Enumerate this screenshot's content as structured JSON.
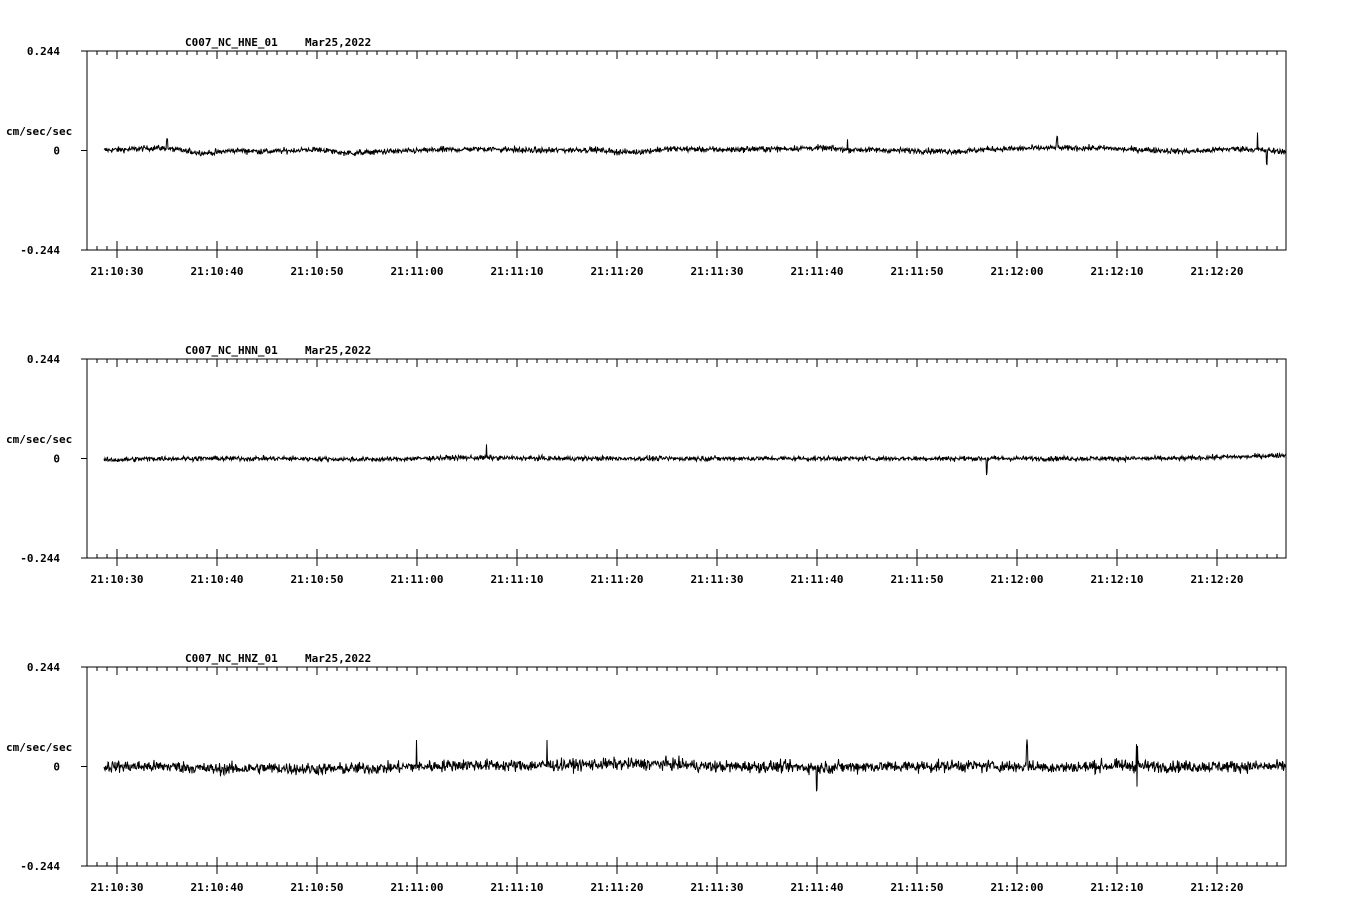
{
  "chart_data": [
    {
      "type": "line",
      "title": "C007_NC_HNE_01",
      "date": "Mar25,2022",
      "ylabel": "cm/sec/sec",
      "y_ticks": [
        "0.244",
        "0",
        "-0.244"
      ],
      "ylim": [
        -0.244,
        0.244
      ],
      "x_ticks": [
        "21:10:30",
        "21:10:40",
        "21:10:50",
        "21:11:00",
        "21:11:10",
        "21:11:20",
        "21:11:30",
        "21:11:40",
        "21:11:50",
        "21:12:00",
        "21:12:10",
        "21:12:20"
      ],
      "series": [
        {
          "color": "#000000",
          "noise_amplitude": 0.012,
          "x": [
            "21:10:28",
            "21:10:30",
            "21:10:34",
            "21:10:39",
            "21:10:42",
            "21:10:45",
            "21:10:50",
            "21:10:53",
            "21:10:58",
            "21:11:03",
            "21:11:07",
            "21:11:12",
            "21:11:17",
            "21:11:21",
            "21:11:26",
            "21:11:30",
            "21:11:35",
            "21:11:40",
            "21:11:44",
            "21:11:49",
            "21:11:54",
            "21:11:58",
            "21:12:03",
            "21:12:08",
            "21:12:12",
            "21:12:17",
            "21:12:22",
            "21:12:27"
          ],
          "values": [
            0.0,
            0.002,
            0.006,
            -0.006,
            0.0,
            -0.002,
            0.002,
            -0.006,
            -0.002,
            0.002,
            0.004,
            0.0,
            0.002,
            -0.004,
            0.004,
            0.002,
            0.004,
            0.006,
            0.002,
            0.0,
            -0.002,
            0.004,
            0.006,
            0.006,
            0.002,
            -0.002,
            0.004,
            -0.002
          ],
          "peaks": [
            {
              "x": "21:10:35",
              "value": 0.03
            },
            {
              "x": "21:11:43",
              "value": 0.028
            },
            {
              "x": "21:12:04",
              "value": 0.035
            },
            {
              "x": "21:12:24",
              "value": 0.045
            },
            {
              "x": "21:12:25",
              "value": -0.035
            }
          ]
        }
      ]
    },
    {
      "type": "line",
      "title": "C007_NC_HNN_01",
      "date": "Mar25,2022",
      "ylabel": "cm/sec/sec",
      "y_ticks": [
        "0.244",
        "0",
        "-0.244"
      ],
      "ylim": [
        -0.244,
        0.244
      ],
      "x_ticks": [
        "21:10:30",
        "21:10:40",
        "21:10:50",
        "21:11:00",
        "21:11:10",
        "21:11:20",
        "21:11:30",
        "21:11:40",
        "21:11:50",
        "21:12:00",
        "21:12:10",
        "21:12:20"
      ],
      "series": [
        {
          "color": "#000000",
          "noise_amplitude": 0.01,
          "x": [
            "21:10:28",
            "21:10:35",
            "21:10:45",
            "21:10:55",
            "21:11:05",
            "21:11:15",
            "21:11:25",
            "21:11:35",
            "21:11:45",
            "21:11:55",
            "21:12:05",
            "21:12:15",
            "21:12:22",
            "21:12:27"
          ],
          "values": [
            -0.004,
            0.0,
            0.0,
            -0.002,
            0.002,
            0.0,
            0.0,
            0.0,
            0.0,
            0.0,
            0.0,
            0.0,
            0.004,
            0.008
          ],
          "peaks": [
            {
              "x": "21:11:07",
              "value": 0.035
            },
            {
              "x": "21:11:57",
              "value": -0.045
            },
            {
              "x": "21:12:27",
              "value": 0.04
            }
          ]
        }
      ]
    },
    {
      "type": "line",
      "title": "C007_NC_HNZ_01",
      "date": "Mar25,2022",
      "ylabel": "cm/sec/sec",
      "y_ticks": [
        "0.244",
        "0",
        "-0.244"
      ],
      "ylim": [
        -0.244,
        0.244
      ],
      "x_ticks": [
        "21:10:30",
        "21:10:40",
        "21:10:50",
        "21:11:00",
        "21:11:10",
        "21:11:20",
        "21:11:30",
        "21:11:40",
        "21:11:50",
        "21:12:00",
        "21:12:10",
        "21:12:20"
      ],
      "series": [
        {
          "color": "#000000",
          "noise_amplitude": 0.025,
          "x": [
            "21:10:28",
            "21:10:35",
            "21:10:40",
            "21:10:45",
            "21:10:50",
            "21:10:56",
            "21:11:00",
            "21:11:05",
            "21:11:10",
            "21:11:15",
            "21:11:20",
            "21:11:25",
            "21:11:30",
            "21:11:35",
            "21:11:40",
            "21:11:45",
            "21:11:50",
            "21:11:55",
            "21:12:00",
            "21:12:05",
            "21:12:10",
            "21:12:15",
            "21:12:20",
            "21:12:27"
          ],
          "values": [
            0.0,
            0.0,
            -0.006,
            -0.004,
            -0.006,
            -0.004,
            0.0,
            0.004,
            0.002,
            0.004,
            0.006,
            0.006,
            0.0,
            0.0,
            -0.002,
            0.0,
            0.0,
            0.002,
            0.0,
            -0.002,
            0.002,
            0.0,
            0.0,
            0.0
          ],
          "peaks": [
            {
              "x": "21:11:00",
              "value": 0.09
            },
            {
              "x": "21:11:13",
              "value": 0.075
            },
            {
              "x": "21:11:40",
              "value": -0.07
            },
            {
              "x": "21:12:01",
              "value": 0.07
            },
            {
              "x": "21:12:12",
              "value": -0.065
            },
            {
              "x": "21:12:12",
              "value": 0.065
            }
          ]
        }
      ]
    }
  ]
}
